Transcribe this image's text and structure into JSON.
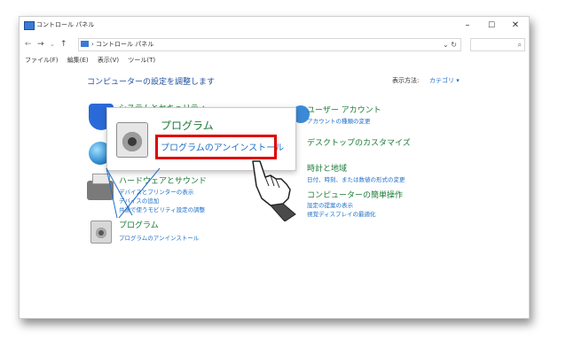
{
  "window": {
    "title": "コントロール パネル",
    "controls": {
      "minimize": "–",
      "maximize": "☐",
      "close": "✕"
    }
  },
  "addressbar": {
    "nav_back": "←",
    "nav_forward": "→",
    "nav_dropdown": "⌄",
    "nav_up": "↑",
    "path_separator": "›",
    "path": "コントロール パネル",
    "dropdown": "⌄",
    "refresh": "↻",
    "search_icon": "⌕"
  },
  "menubar": {
    "items": [
      "ファイル(F)",
      "編集(E)",
      "表示(V)",
      "ツール(T)"
    ]
  },
  "content": {
    "heading": "コンピューターの設定を調整します",
    "view_label": "表示方法:",
    "view_value": "カテゴリ ▾",
    "left_categories": [
      {
        "title": "システムとセキュリティ",
        "links": []
      },
      {
        "title": "ハードウェアとサウンド",
        "links": [
          "デバイスとプリンターの表示",
          "デバイスの追加",
          "共通で使うモビリティ設定の調整"
        ]
      },
      {
        "title": "プログラム",
        "links": [
          "プログラムのアンインストール"
        ]
      }
    ],
    "right_categories": [
      {
        "title": "ユーザー アカウント",
        "links": [
          "アカウントの種類の変更"
        ]
      },
      {
        "title": "デスクトップのカスタマイズ",
        "links": []
      },
      {
        "title": "時計と地域",
        "links": [
          "日付、時刻、または数値の形式の変更"
        ]
      },
      {
        "title": "コンピューターの簡単操作",
        "links": [
          "設定の提案の表示",
          "視覚ディスプレイの最適化"
        ]
      }
    ]
  },
  "popup": {
    "title": "プログラム",
    "link": "プログラムのアンインストール"
  },
  "colors": {
    "category_green": "#1a7a35",
    "link_blue": "#1e6fc8",
    "highlight_red": "#e00000"
  }
}
